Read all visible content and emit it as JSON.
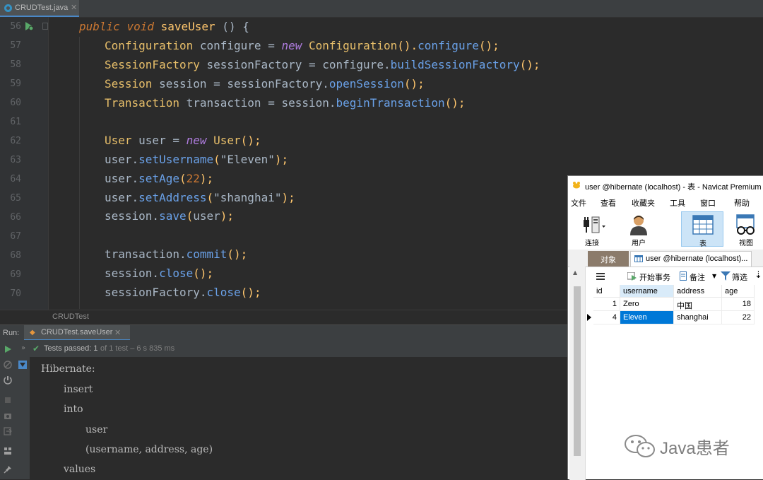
{
  "editor": {
    "tab_label": "CRUDTest.java",
    "line_numbers": [
      "56",
      "57",
      "58",
      "59",
      "60",
      "61",
      "62",
      "63",
      "64",
      "65",
      "66",
      "67",
      "68",
      "69",
      "70"
    ],
    "breadcrumb": "CRUDTest"
  },
  "code": {
    "l56": {
      "k1": "public",
      "k2": "void",
      "name": "saveUser",
      "rest": " () {"
    },
    "l57": {
      "type": "Configuration",
      "var": " configure = ",
      "kw": "new",
      "ctor": " Configuration",
      "p1": "().",
      "call": "configure",
      "p2": "();"
    },
    "l58": {
      "type": "SessionFactory",
      "var": " sessionFactory = configure.",
      "call": "buildSessionFactory",
      "p2": "();"
    },
    "l59": {
      "type": "Session",
      "var": " session = sessionFactory.",
      "call": "openSession",
      "p2": "();"
    },
    "l60": {
      "type": "Transaction",
      "var": " transaction = session.",
      "call": "beginTransaction",
      "p2": "();"
    },
    "l62": {
      "type": "User",
      "var": " user = ",
      "kw": "new",
      "ctor": " User",
      "p2": "();"
    },
    "l63": {
      "obj": "user.",
      "call": "setUsername",
      "p1": "(",
      "str": "\"Eleven\"",
      "p2": ");"
    },
    "l64": {
      "obj": "user.",
      "call": "setAge",
      "p1": "(",
      "num": "22",
      "p2": ");"
    },
    "l65": {
      "obj": "user.",
      "call": "setAddress",
      "p1": "(",
      "str": "\"shanghai\"",
      "p2": ");"
    },
    "l66": {
      "obj": "session.",
      "call": "save",
      "p1": "(",
      "arg": "user",
      "p2": ");"
    },
    "l68": {
      "obj": "transaction.",
      "call": "commit",
      "p2": "();"
    },
    "l69": {
      "obj": "session.",
      "call": "close",
      "p2": "();"
    },
    "l70": {
      "obj": "sessionFactory.",
      "call": "close",
      "p2": "();"
    }
  },
  "run": {
    "label": "Run:",
    "tab_label": "CRUDTest.saveUser",
    "status_passed": "Tests passed: 1",
    "status_rest": "of 1 test – 6 s 835 ms",
    "console_lines": [
      "Hibernate:",
      "insert",
      "into",
      "user",
      "(username, address, age)",
      "values"
    ]
  },
  "navicat": {
    "title": "user @hibernate (localhost) - 表 - Navicat Premium",
    "menu": [
      "文件",
      "查看",
      "收藏夹",
      "工具",
      "窗口",
      "帮助"
    ],
    "toolbar": [
      "连接",
      "用户",
      "表",
      "视图"
    ],
    "tab_objects": "对象",
    "tab_table": "user @hibernate (localhost)...",
    "subtoolbar": {
      "begin_tx": "开始事务",
      "memo": "备注",
      "filter": "筛选"
    },
    "columns": [
      "id",
      "username",
      "address",
      "age"
    ],
    "rows": [
      {
        "id": "1",
        "username": "Zero",
        "address": "中国",
        "age": "18"
      },
      {
        "id": "4",
        "username": "Eleven",
        "address": "shanghai",
        "age": "22"
      }
    ]
  },
  "watermark": "Java患者",
  "colors": {
    "keyword": "#cc7832",
    "type": "#e8bf6a",
    "string": "#6a8759",
    "number": "#ba8eff",
    "method": "#6aa1e8",
    "pass": "#59a869",
    "selection": "#0078d7"
  }
}
